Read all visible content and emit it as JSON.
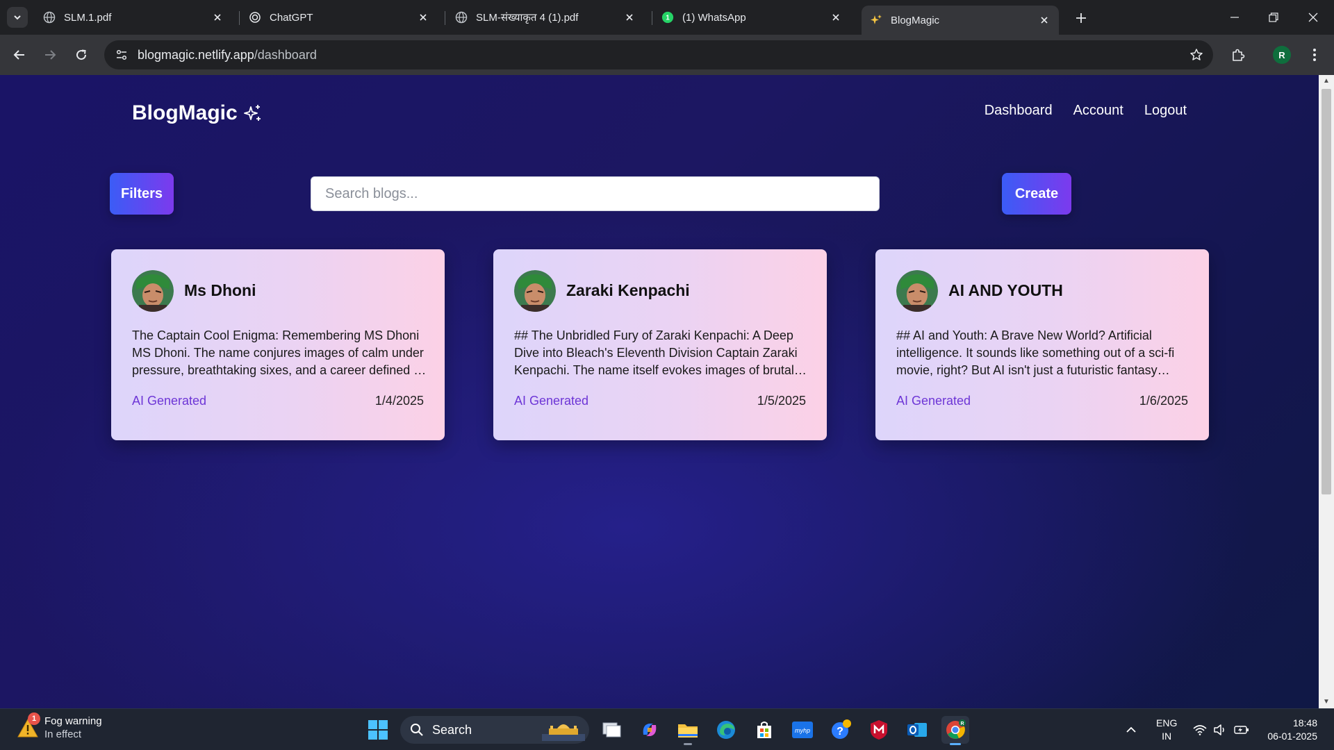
{
  "browser": {
    "tabs": [
      {
        "title": "SLM.1.pdf",
        "icon": "globe-icon"
      },
      {
        "title": "ChatGPT",
        "icon": "openai-icon"
      },
      {
        "title": "SLM-संख्याकृत 4 (1).pdf",
        "icon": "globe-icon"
      },
      {
        "title": "(1) WhatsApp",
        "icon": "whatsapp-icon"
      },
      {
        "title": "BlogMagic",
        "icon": "sparkle-icon",
        "active": true
      }
    ],
    "url_host": "blogmagic.netlify.app",
    "url_path": "/dashboard",
    "profile_initial": "R"
  },
  "app": {
    "brand": "BlogMagic",
    "nav": {
      "dashboard": "Dashboard",
      "account": "Account",
      "logout": "Logout"
    },
    "filters_label": "Filters",
    "create_label": "Create",
    "search_placeholder": "Search blogs...",
    "cards": [
      {
        "title": "Ms Dhoni",
        "excerpt": "The Captain Cool Enigma: Remembering MS Dhoni MS Dhoni. The name conjures images of calm under pressure, breathtaking sixes, and a career defined by remarkable consistency and leadership.",
        "tag": "AI Generated",
        "date": "1/4/2025"
      },
      {
        "title": "Zaraki Kenpachi",
        "excerpt": "## The Unbridled Fury of Zaraki Kenpachi: A Deep Dive into Bleach's Eleventh Division Captain Zaraki Kenpachi. The name itself evokes images of brutal strength and an endless thirst for battle.",
        "tag": "AI Generated",
        "date": "1/5/2025"
      },
      {
        "title": "AI AND YOUTH",
        "excerpt": "## AI and Youth: A Brave New World? Artificial intelligence. It sounds like something out of a sci-fi movie, right? But AI isn't just a futuristic fantasy anymore.",
        "tag": "AI Generated",
        "date": "1/6/2025"
      }
    ],
    "colors": {
      "accent_start": "#3b5cf6",
      "accent_end": "#7c3aed",
      "tag": "#6d35d6"
    }
  },
  "taskbar": {
    "weather_title": "Fog warning",
    "weather_sub": "In effect",
    "weather_badge": "1",
    "search_label": "Search",
    "lang_top": "ENG",
    "lang_bottom": "IN",
    "time": "18:48",
    "date": "06-01-2025"
  }
}
